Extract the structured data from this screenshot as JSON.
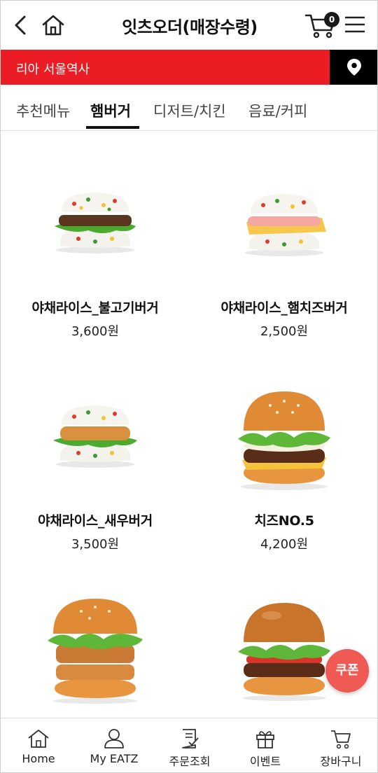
{
  "header": {
    "title": "잇츠오더(매장수령)",
    "cart_count": "0"
  },
  "store": {
    "name": "리아 서울역사",
    "accent": "#ec1c24"
  },
  "tabs": [
    {
      "label": "추천메뉴"
    },
    {
      "label": "햄버거"
    },
    {
      "label": "디저트/치킨"
    },
    {
      "label": "음료/커피"
    }
  ],
  "products": [
    {
      "name": "야채라이스_불고기버거",
      "price": "3,600원"
    },
    {
      "name": "야채라이스_햄치즈버거",
      "price": "2,500원"
    },
    {
      "name": "야채라이스_새우버거",
      "price": "3,500원"
    },
    {
      "name": "치즈NO.5",
      "price": "4,200원"
    },
    {
      "name": "",
      "price": ""
    },
    {
      "name": "",
      "price": ""
    }
  ],
  "coupon": {
    "label": "쿠폰",
    "color": "#ef5a55"
  },
  "bottom_nav": [
    {
      "label": "Home",
      "icon": "home-icon"
    },
    {
      "label": "My EATZ",
      "icon": "person-icon"
    },
    {
      "label": "주문조회",
      "icon": "order-list-icon"
    },
    {
      "label": "이벤트",
      "icon": "gift-icon"
    },
    {
      "label": "장바구니",
      "icon": "cart-icon"
    }
  ]
}
